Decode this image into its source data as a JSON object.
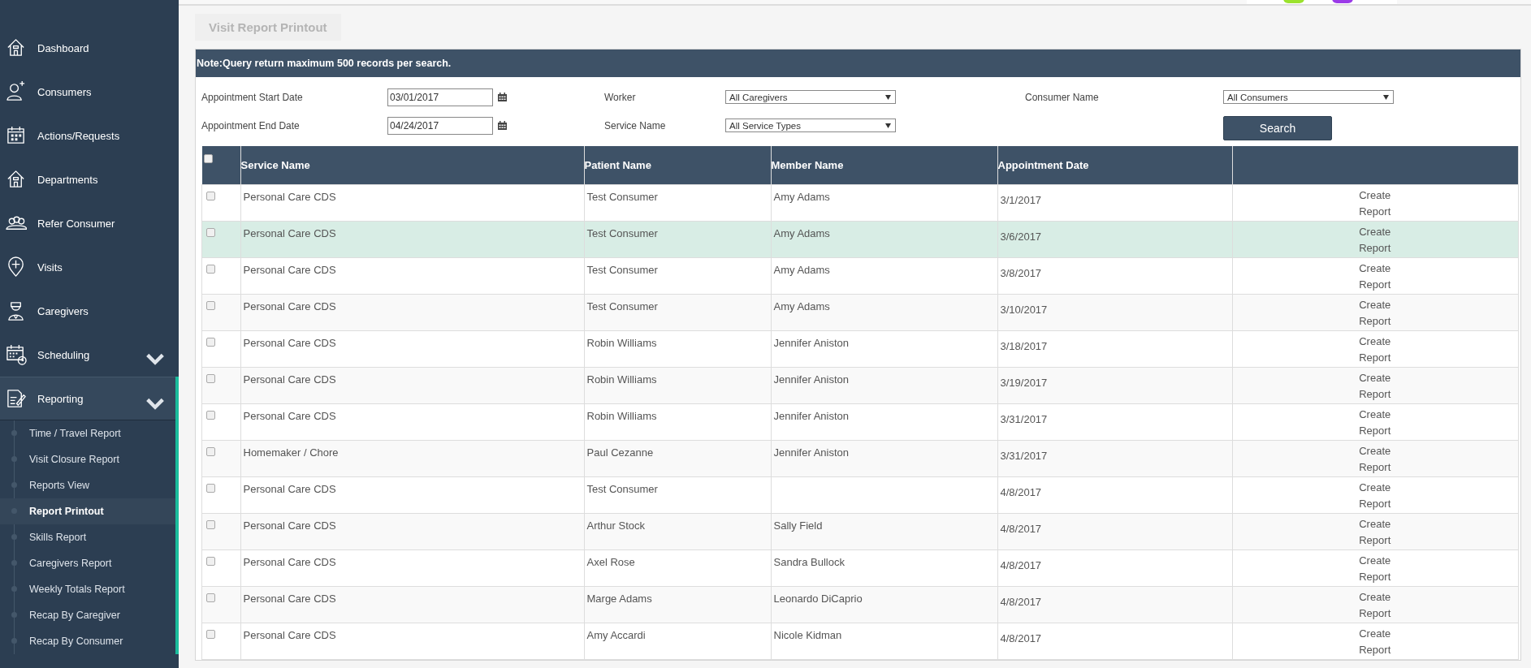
{
  "sidebar": {
    "items": [
      {
        "label": "Dashboard",
        "kind": "link"
      },
      {
        "label": "Consumers",
        "kind": "link"
      },
      {
        "label": "Actions/Requests",
        "kind": "link"
      },
      {
        "label": "Departments",
        "kind": "link"
      },
      {
        "label": "Refer Consumer",
        "kind": "link"
      },
      {
        "label": "Visits",
        "kind": "link"
      },
      {
        "label": "Caregivers",
        "kind": "link"
      },
      {
        "label": "Scheduling",
        "kind": "group",
        "expanded": false
      },
      {
        "label": "Reporting",
        "kind": "group",
        "expanded": true,
        "children": [
          {
            "label": "Time / Travel Report",
            "selected": false
          },
          {
            "label": "Visit Closure Report",
            "selected": false
          },
          {
            "label": "Reports View",
            "selected": false
          },
          {
            "label": "Report Printout",
            "selected": true
          },
          {
            "label": "Skills Report",
            "selected": false
          },
          {
            "label": "Caregivers Report",
            "selected": false
          },
          {
            "label": "Weekly Totals Report",
            "selected": false
          },
          {
            "label": "Recap By Caregiver",
            "selected": false
          },
          {
            "label": "Recap By Consumer",
            "selected": false
          }
        ]
      }
    ]
  },
  "page_title": "Visit Report Printout",
  "note": "Note:Query return maximum 500 records per search.",
  "filters": {
    "start_date": {
      "label": "Appointment Start Date",
      "value": "03/01/2017"
    },
    "end_date": {
      "label": "Appointment End Date",
      "value": "04/24/2017"
    },
    "worker": {
      "label": "Worker",
      "value": "All Caregivers"
    },
    "service": {
      "label": "Service Name",
      "value": "All Service Types"
    },
    "consumer": {
      "label": "Consumer Name",
      "value": "All Consumers"
    },
    "search_button": "Search"
  },
  "table": {
    "select_all_checked": false,
    "columns": [
      "Service Name",
      "Patient Name",
      "Member Name",
      "Appointment Date"
    ],
    "rows": [
      {
        "service": "Personal Care CDS",
        "patient": "Test Consumer",
        "member": "Amy Adams",
        "date": "3/1/2017",
        "action": "Create Report",
        "checked": false,
        "highlighted": false
      },
      {
        "service": "Personal Care CDS",
        "patient": "Test Consumer",
        "member": "Amy Adams",
        "date": "3/6/2017",
        "action": "Create Report",
        "checked": false,
        "highlighted": true
      },
      {
        "service": "Personal Care CDS",
        "patient": "Test Consumer",
        "member": "Amy Adams",
        "date": "3/8/2017",
        "action": "Create Report",
        "checked": false,
        "highlighted": false
      },
      {
        "service": "Personal Care CDS",
        "patient": "Test Consumer",
        "member": "Amy Adams",
        "date": "3/10/2017",
        "action": "Create Report",
        "checked": false,
        "highlighted": false
      },
      {
        "service": "Personal Care CDS",
        "patient": "Robin Williams",
        "member": "Jennifer Aniston",
        "date": "3/18/2017",
        "action": "Create Report",
        "checked": false,
        "highlighted": false
      },
      {
        "service": "Personal Care CDS",
        "patient": "Robin Williams",
        "member": "Jennifer Aniston",
        "date": "3/19/2017",
        "action": "Create Report",
        "checked": false,
        "highlighted": false
      },
      {
        "service": "Personal Care CDS",
        "patient": "Robin Williams",
        "member": "Jennifer Aniston",
        "date": "3/31/2017",
        "action": "Create Report",
        "checked": false,
        "highlighted": false
      },
      {
        "service": "Homemaker / Chore",
        "patient": "Paul Cezanne",
        "member": "Jennifer Aniston",
        "date": "3/31/2017",
        "action": "Create Report",
        "checked": false,
        "highlighted": false
      },
      {
        "service": "Personal Care CDS",
        "patient": "Test Consumer",
        "date": "4/8/2017",
        "action": "Create Report",
        "checked": false,
        "highlighted": false
      },
      {
        "service": "Personal Care CDS",
        "patient": "Arthur Stock",
        "member": "Sally Field",
        "date": "4/8/2017",
        "action": "Create Report",
        "checked": false,
        "highlighted": false
      },
      {
        "service": "Personal Care CDS",
        "patient": "Axel Rose",
        "member": "Sandra Bullock",
        "date": "4/8/2017",
        "action": "Create Report",
        "checked": false,
        "highlighted": false
      },
      {
        "service": "Personal Care CDS",
        "patient": "Marge Adams",
        "member": "Leonardo DiCaprio",
        "date": "4/8/2017",
        "action": "Create Report",
        "checked": false,
        "highlighted": false
      },
      {
        "service": "Personal Care CDS",
        "patient": "Amy Accardi",
        "member": "Nicole Kidman",
        "date": "4/8/2017",
        "action": "Create Report",
        "checked": false,
        "highlighted": false
      }
    ]
  }
}
